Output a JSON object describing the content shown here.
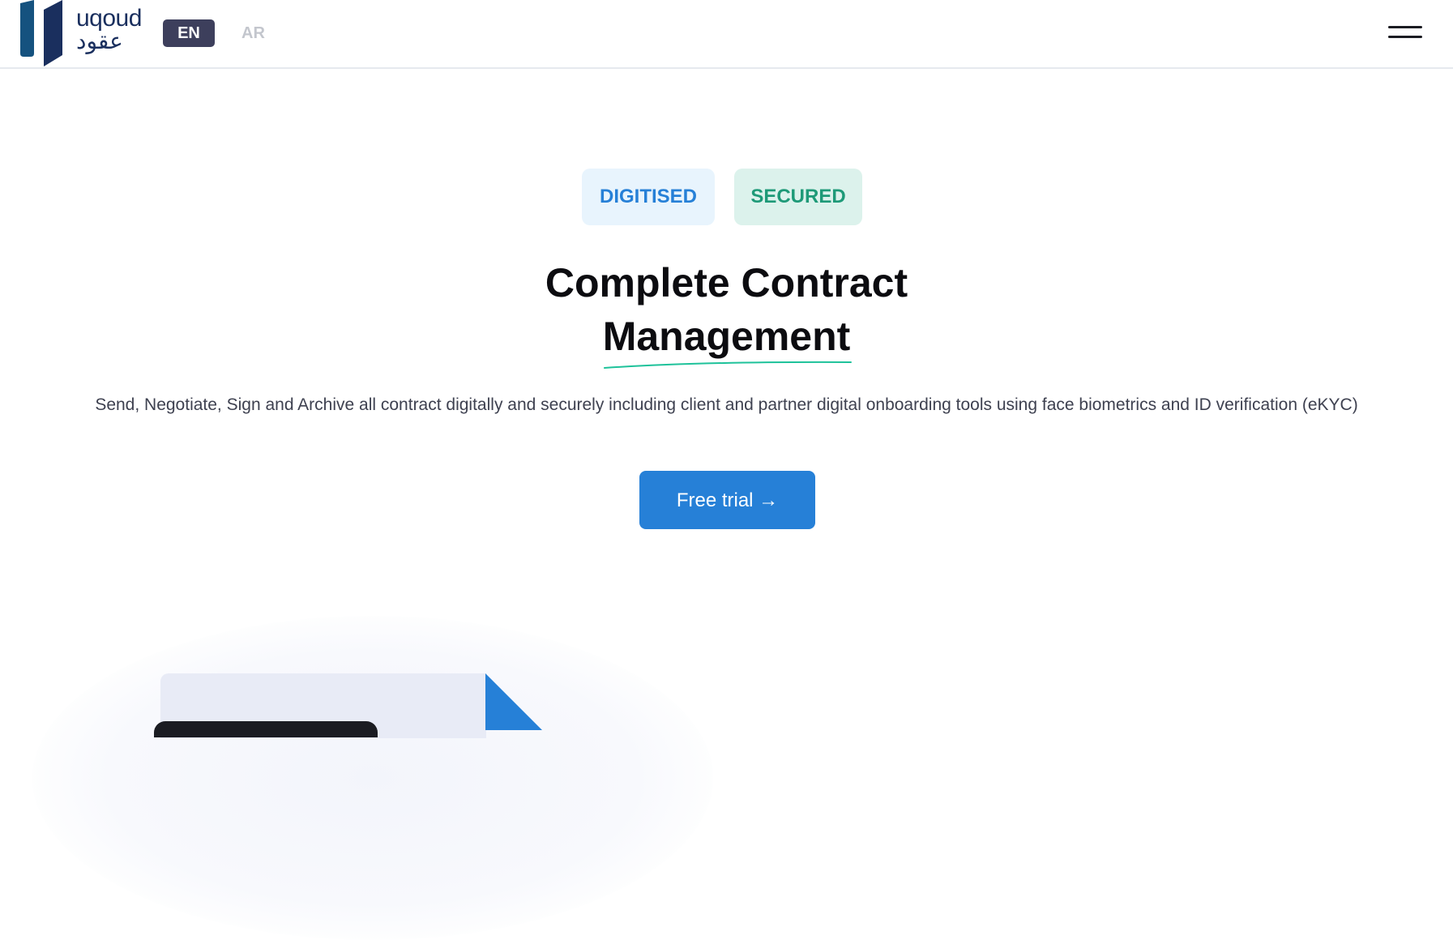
{
  "header": {
    "logo_text_en": "uqoud",
    "logo_text_ar": "عقود",
    "lang_en": "EN",
    "lang_ar": "AR",
    "menu_icon": "hamburger-icon"
  },
  "hero": {
    "tags": [
      "DIGITISED",
      "SECURED"
    ],
    "title_line1": "Complete Contract",
    "title_line2": "Management",
    "subtitle": "Send, Negotiate, Sign and Archive all contract digitally and securely including client and partner digital onboarding tools using face biometrics and ID verification (eKYC)",
    "cta_label": "Free trial →"
  },
  "colors": {
    "brand_navy": "#1a2f5e",
    "brand_blue": "#2680d7",
    "accent_green": "#1e9a78",
    "lang_active_bg": "#3d3f5c"
  }
}
